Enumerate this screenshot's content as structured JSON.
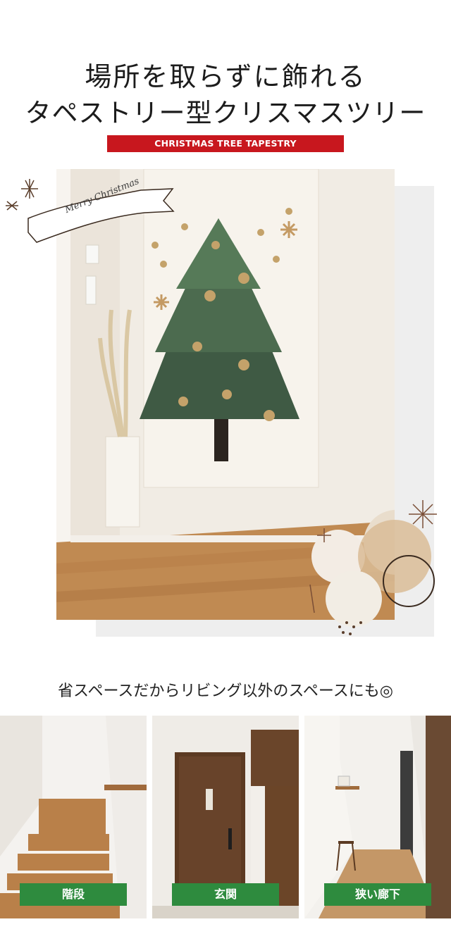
{
  "header": {
    "line1": "場所を取らずに飾れる",
    "line2": "タペストリー型クリスマスツリー",
    "ribbon": "CHRISTMAS TREE TAPESTRY"
  },
  "decor": {
    "banner_text": "Merry Christmas"
  },
  "subtitle": "省スペースだからリビング以外のスペースにも◎",
  "places": [
    {
      "label": "階段"
    },
    {
      "label": "玄関"
    },
    {
      "label": "狭い廊下"
    }
  ],
  "colors": {
    "ribbon": "#c8171e",
    "tag": "#2e8b3e"
  }
}
